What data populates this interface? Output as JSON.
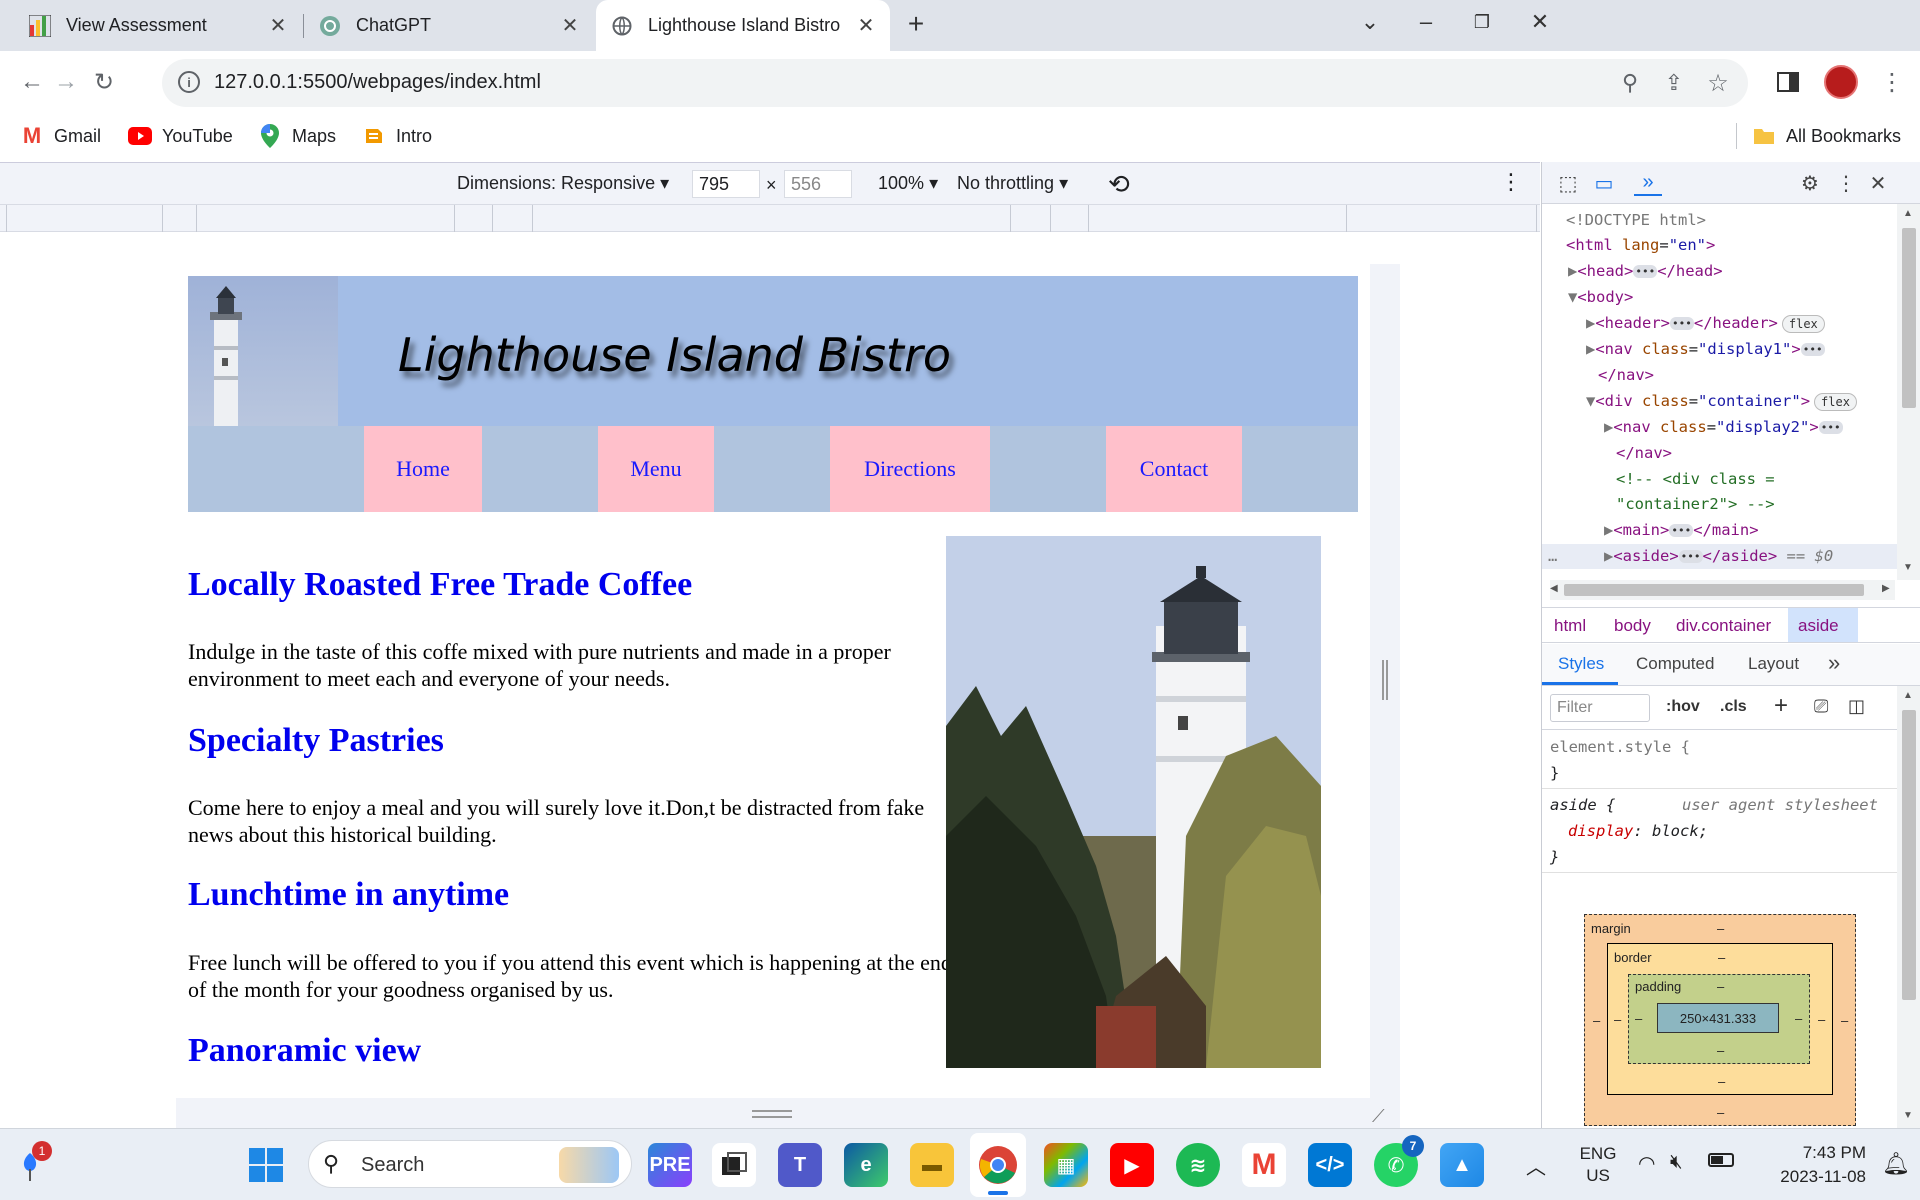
{
  "browser": {
    "tabs": [
      {
        "title": "View Assessment",
        "icon": "bar-chart-favicon"
      },
      {
        "title": "ChatGPT",
        "icon": "chatgpt-favicon"
      },
      {
        "title": "Lighthouse Island Bistro",
        "icon": "globe-favicon",
        "active": true
      }
    ],
    "url": "127.0.0.1:5500/webpages/index.html",
    "bookmarks": [
      {
        "label": "Gmail"
      },
      {
        "label": "YouTube"
      },
      {
        "label": "Maps"
      },
      {
        "label": "Intro"
      }
    ],
    "all_bookmarks": "All Bookmarks"
  },
  "device_toolbar": {
    "dimensions": "Dimensions: Responsive",
    "width": "795",
    "height": "556",
    "times": "×",
    "zoom": "100%",
    "throttling": "No throttling"
  },
  "site": {
    "title": "Lighthouse Island Bistro",
    "nav": [
      "Home",
      "Menu",
      "Directions",
      "Contact"
    ],
    "sections": [
      {
        "heading": "Locally Roasted Free Trade Coffee",
        "text": "Indulge in the taste of this coffe mixed with pure nutrients and made in a proper environment to meet each and everyone of your needs."
      },
      {
        "heading": "Specialty Pastries",
        "text": "Come here to enjoy a meal and you will surely love it.Don,t be distracted from fake news about this historical building."
      },
      {
        "heading": "Lunchtime in anytime",
        "text": "Free lunch will be offered to you if you attend this event which is happening at the end of the month for your goodness organised by us."
      },
      {
        "heading": "Panoramic view",
        "text": ""
      }
    ]
  },
  "devtools": {
    "dom": {
      "doctype": "<!DOCTYPE html>",
      "html_open": "<html",
      "lang_attr": "lang",
      "lang_val": "\"en\"",
      "head": "<head>",
      "head_close": "</head>",
      "body": "<body>",
      "header": "<header>",
      "header_close": "</header>",
      "flex": "flex",
      "nav_open": "<nav",
      "class_attr": "class",
      "display1": "\"display1\"",
      "nav_close": "</nav>",
      "div_open": "<div",
      "container": "\"container\"",
      "display2": "\"display2\"",
      "comment1": "<!-- <div class =",
      "comment2": "\"container2\"> -->",
      "main": "<main>",
      "main_close": "</main>",
      "aside": "<aside>",
      "aside_close": "</aside>",
      "selected_marker": "== $0"
    },
    "breadcrumbs": [
      "html",
      "body",
      "div.container",
      "aside"
    ],
    "style_tabs": [
      "Styles",
      "Computed",
      "Layout"
    ],
    "filter_placeholder": "Filter",
    "hov": ":hov",
    "cls": ".cls",
    "styles": {
      "element_style": "element.style {",
      "close_brace": "}",
      "aside_selector": "aside {",
      "user_agent": "user agent stylesheet",
      "display_prop": "display",
      "display_val": "block;"
    },
    "box_model": {
      "margin": "margin",
      "border": "border",
      "padding": "padding",
      "dash": "–",
      "content": "250×431.333"
    }
  },
  "taskbar": {
    "search": "Search",
    "notification_count": "1",
    "whatsapp_badge": "7",
    "language": "ENG",
    "region": "US",
    "time": "7:43 PM",
    "date": "2023-11-08"
  }
}
